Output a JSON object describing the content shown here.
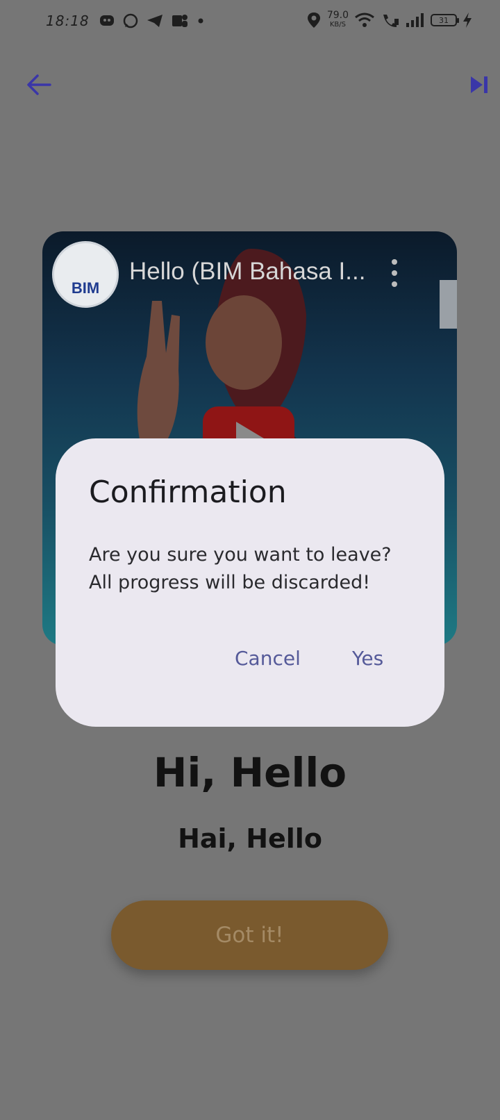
{
  "status_bar": {
    "time": "18:18",
    "network_speed": "79.0",
    "network_unit": "KB/S",
    "battery": "31"
  },
  "video": {
    "title": "Hello (BIM Bahasa I...",
    "channel_logo_text": "BIM"
  },
  "word": {
    "english": "Hi, Hello",
    "malay": "Hai, Hello"
  },
  "got_it_label": "Got it!",
  "dialog": {
    "title": "Confirmation",
    "message": "Are you sure you want to leave?\nAll progress will be discarded!",
    "cancel_label": "Cancel",
    "yes_label": "Yes"
  },
  "colors": {
    "accent": "#3a36a8",
    "dialog_bg": "#ebe8f0",
    "dialog_button": "#555a99",
    "got_it_bg": "#7a5a2e",
    "scrim": "#767676"
  }
}
